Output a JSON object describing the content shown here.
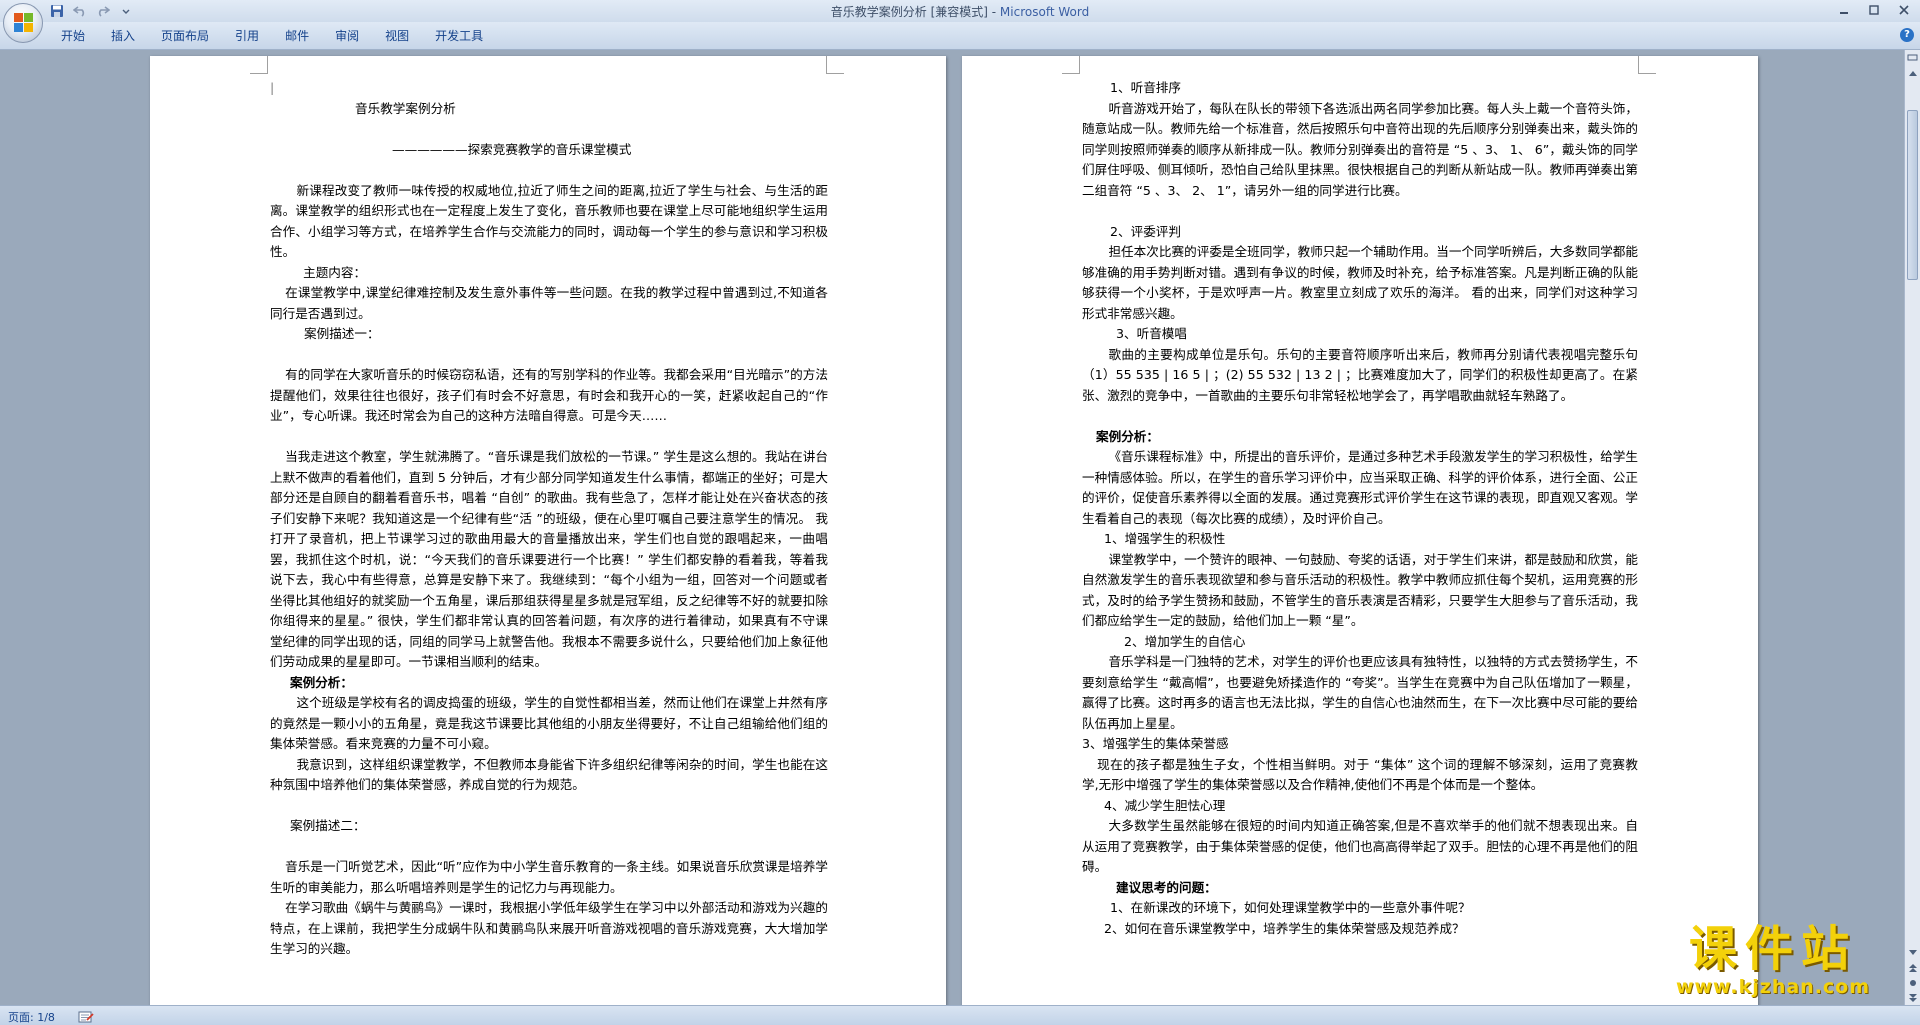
{
  "window": {
    "title_doc": "音乐教学案例分析 [兼容模式] - ",
    "title_app": "Microsoft Word"
  },
  "ribbon": {
    "tabs": [
      "开始",
      "插入",
      "页面布局",
      "引用",
      "邮件",
      "审阅",
      "视图",
      "开发工具"
    ]
  },
  "status": {
    "page": "页面: 1/8"
  },
  "watermark": {
    "text": "课件站",
    "url": "www.kjzhan.com"
  },
  "page1": {
    "title": "音乐教学案例分析",
    "subtitle": "——————探索竞赛教学的音乐课堂模式",
    "intro": "新课程改变了教师一味传授的权威地位,拉近了师生之间的距离,拉近了学生与社会、与生活的距离。课堂教学的组织形式也在一定程度上发生了变化，音乐教师也要在课堂上尽可能地组织学生运用合作、小组学习等方式，在培养学生合作与交流能力的同时，调动每一个学生的参与意识和学习积极性。",
    "theme_label": "主题内容：",
    "theme": "在课堂教学中,课堂纪律难控制及发生意外事件等一些问题。在我的教学过程中曾遇到过,不知道各同行是否遇到过。",
    "case1_label": "案例描述一：",
    "case1_p1": "有的同学在大家听音乐的时候窃窃私语，还有的写别学科的作业等。我都会采用“目光暗示”的方法提醒他们，效果往往也很好，孩子们有时会不好意思，有时会和我开心的一笑，赶紧收起自己的“作业”，专心听课。我还时常会为自己的这种方法暗自得意。可是今天……",
    "case1_p2": "当我走进这个教室，学生就沸腾了。“音乐课是我们放松的一节课。” 学生是这么想的。我站在讲台上默不做声的看着他们，直到 5 分钟后，才有少部分同学知道发生什么事情，都端正的坐好；可是大部分还是自顾自的翻着看音乐书，唱着 “自创” 的歌曲。我有些急了，怎样才能让处在兴奋状态的孩子们安静下来呢？我知道这是一个纪律有些“活 ”的班级，便在心里叮嘱自己要注意学生的情况。  我打开了录音机，把上节课学习过的歌曲用最大的音量播放出来，学生们也自觉的跟唱起来，一曲唱罢，我抓住这个时机，说：“今天我们的音乐课要进行一个比赛！” 学生们都安静的看着我，等着我说下去，我心中有些得意，总算是安静下来了。我继续到：“每个小组为一组，回答对一个问题或者坐得比其他组好的就奖励一个五角星，课后那组获得星星多就是冠军组，反之纪律等不好的就要扣除你组得来的星星。” 很快，学生们都非常认真的回答着问题，有次序的进行着律动，如果真有不守课堂纪律的同学出现的话，同组的同学马上就警告他。我根本不需要多说什么，只要给他们加上象征他们劳动成果的星星即可。一节课相当顺利的结束。",
    "analysis1_label": "案例分析：",
    "analysis1_p1": "这个班级是学校有名的调皮捣蛋的班级，学生的自觉性都相当差，然而让他们在课堂上井然有序的竟然是一颗小小的五角星，竟是我这节课要比其他组的小朋友坐得要好，不让自己组输给他们组的集体荣誉感。看来竞赛的力量不可小窥。",
    "analysis1_p2": "我意识到，这样组织课堂教学，不但教师本身能省下许多组织纪律等闲杂的时间，学生也能在这种氛围中培养他们的集体荣誉感，养成自觉的行为规范。",
    "case2_label": "案例描述二：",
    "case2_p1": "音乐是一门听觉艺术，因此“听”应作为中小学生音乐教育的一条主线。如果说音乐欣赏课是培养学生听的审美能力，那么听唱培养则是学生的记忆力与再现能力。",
    "case2_p2": "在学习歌曲《蜗牛与黄鹂鸟》一课时，我根据小学低年级学生在学习中以外部活动和游戏为兴趣的特点，在上课前，我把学生分成蜗牛队和黄鹂鸟队来展开听音游戏视唱的音乐游戏竞赛，大大增加学生学习的兴趣。"
  },
  "page2": {
    "h1": "1、听音排序",
    "p1": "听音游戏开始了，每队在队长的带领下各选派出两名同学参加比赛。每人头上戴一个音符头饰，随意站成一队。教师先给一个标准音，然后按照乐句中音符出现的先后顺序分别弹奏出来，戴头饰的同学则按照师弹奏的顺序从新排成一队。教师分别弹奏出的音符是 “5 、3、 1、 6”，戴头饰的同学们屏住呼吸、侧耳倾听，恐怕自己给队里抹黑。很快根据自己的判断从新站成一队。教师再弹奏出第二组音符 “5  、3、 2、 1”，请另外一组的同学进行比赛。",
    "h2": "2、评委评判",
    "p2": "担任本次比赛的评委是全班同学，教师只起一个辅助作用。当一个同学听辨后，大多数同学都能够准确的用手势判断对错。遇到有争议的时候，教师及时补充，给予标准答案。凡是判断正确的队能够获得一个小奖杯，于是欢呼声一片。教室里立刻成了欢乐的海洋。 看的出来，同学们对这种学习形式非常感兴趣。",
    "h3": "3、听音模唱",
    "p3": "歌曲的主要构成单位是乐句。乐句的主要音符顺序听出来后，教师再分别请代表视唱完整乐句（1）55  535 | 16 5 | ；(2) 55  532 | 13 2  | ；比赛难度加大了，同学们的积极性却更高了。在紧张、激烈的竞争中，一首歌曲的主要乐句非常轻松地学会了，再学唱歌曲就轻车熟路了。",
    "analysis_label": "案例分析：",
    "a1": "《音乐课程标准》中，所提出的音乐评价，是通过多种艺术手段激发学生的学习积极性，给学生一种情感体验。所以，在学生的音乐学习评价中，应当采取正确、科学的评价体系，进行全面、公正的评价，促使音乐素养得以全面的发展。通过竞赛形式评价学生在这节课的表现，即直观又客观。学生看着自己的表现（每次比赛的成绩），及时评价自己。",
    "b1": "1、增强学生的积极性",
    "b1p": "课堂教学中，一个赞许的眼神、一句鼓励、夸奖的话语，对于学生们来讲，都是鼓励和欣赏，能自然激发学生的音乐表现欲望和参与音乐活动的积极性。教学中教师应抓住每个契机，运用竞赛的形式，及时的给予学生赞扬和鼓励，不管学生的音乐表演是否精彩，只要学生大胆参与了音乐活动，我们都应给学生一定的鼓励，给他们加上一颗 “星”。",
    "b2": "2、增加学生的自信心",
    "b2p": "音乐学科是一门独特的艺术，对学生的评价也更应该具有独特性，以独特的方式去赞扬学生，不要刻意给学生 “戴高帽”，也要避免矫揉造作的 “夸奖”。当学生在竞赛中为自己队伍增加了一颗星，赢得了比赛。这时再多的语言也无法比拟，学生的自信心也油然而生，在下一次比赛中尽可能的要给队伍再加上星星。",
    "b3": "3、增强学生的集体荣誉感",
    "b3p": "现在的孩子都是独生子女，个性相当鲜明。对于 “集体” 这个词的理解不够深刻，运用了竞赛教学,无形中增强了学生的集体荣誉感以及合作精神,使他们不再是个体而是一个整体。",
    "b4": "4、减少学生胆怯心理",
    "b4p": "大多数学生虽然能够在很短的时间内知道正确答案,但是不喜欢举手的他们就不想表现出来。自从运用了竞赛教学，由于集体荣誉感的促使，他们也高高得举起了双手。胆怯的心理不再是他们的阻碍。",
    "q_label": "建议思考的问题：",
    "q1": "1、在新课改的环境下，如何处理课堂教学中的一些意外事件呢？",
    "q2": "2、如何在音乐课堂教学中，培养学生的集体荣誉感及规范养成？"
  },
  "colors": {
    "ribbon_text": "#15428b",
    "watermark": "#f3d10a",
    "workspace": "#9aa9bb"
  }
}
